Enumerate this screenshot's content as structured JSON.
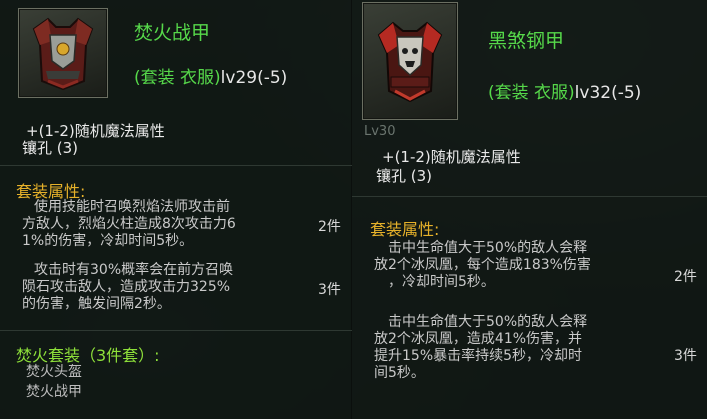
{
  "left": {
    "item_name": "焚火战甲",
    "set_type": "(套装 衣服)",
    "level": "lv29(-5)",
    "random_attr": "+(1-2)随机魔法属性",
    "socket": "镶孔 (3)",
    "set_attr_title": "套装属性:",
    "bonus1_lines": [
      "使用技能时召唤烈焰法师攻击前",
      "方敌人，烈焰火柱造成8次攻击力6",
      "1%的伤害，冷却时间5秒。"
    ],
    "bonus1_count": "2件",
    "bonus2_lines": [
      "攻击时有30%概率会在前方召唤",
      "陨石攻击敌人，造成攻击力325%",
      "的伤害，触发间隔2秒。"
    ],
    "bonus2_count": "3件",
    "set_name": "焚火套装（3件套）:",
    "set_items": [
      "焚火头盔",
      "焚火战甲"
    ]
  },
  "right": {
    "item_name": "黑煞钢甲",
    "set_type": "(套装 衣服)",
    "level": "lv32(-5)",
    "faint_level": "Lv30",
    "random_attr": "+(1-2)随机魔法属性",
    "socket": "镶孔 (3)",
    "set_attr_title": "套装属性:",
    "bonus1_lines": [
      "击中生命值大于50%的敌人会释",
      "放2个冰凤凰，每个造成183%伤害",
      "，冷却时间5秒。"
    ],
    "bonus1_count": "2件",
    "bonus2_lines": [
      "击中生命值大于50%的敌人会释",
      "放2个冰凤凰，造成41%伤害，并",
      "提升15%暴击率持续5秒，冷却时",
      "间5秒。"
    ],
    "bonus2_count": "3件"
  },
  "colors": {
    "green": "#56d84a",
    "gold": "#e6b12a",
    "text": "#c9c9c9"
  },
  "icons": {
    "left": "red-armor-icon",
    "right": "black-steel-armor-icon"
  }
}
